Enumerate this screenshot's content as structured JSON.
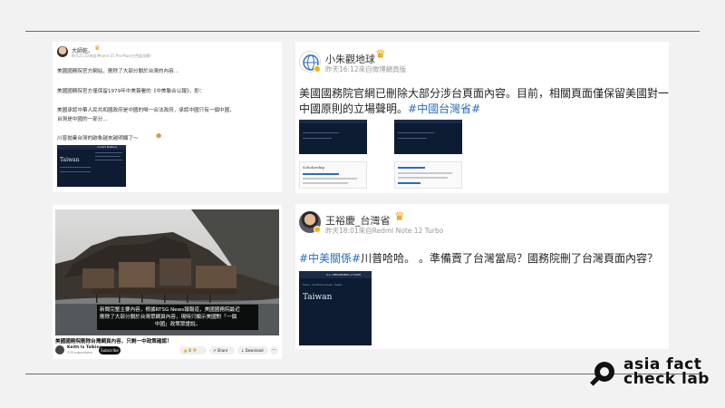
{
  "post1": {
    "user": "大師乾、",
    "meta": "昨天21:22來自iPhone 15 Pro Max(白色鈦金屬)",
    "lines": [
      "美國國務院官方網站，刪除了大部分關於台灣的內容...",
      "美國國務院官方僅保留1979年中美簽署的《中美聯合公報》，即：",
      "美國承認中華人民共和國政府是中國的唯一合法政府，承認中國只有一個中國，",
      "台灣是中國的一部分...",
      "川普拋棄台灣的跡象越來越明顯了～"
    ],
    "thumb_title": "Taiwan",
    "thumb_header": "Content Relations"
  },
  "post2": {
    "user": "小朱觀地球",
    "meta": "昨天16:12來自微博網頁版",
    "line1": "美國國務院官網已刪除大部分涉台頁面內容。目前，相關頁面僅保留美國對一個",
    "line2_text": "中國原則的立場聲明。",
    "line2_tag": "#中國台灣省#",
    "thumb_heading": "Scholarship"
  },
  "post3": {
    "caption_line1": "新聞完整主要內容，根據RTSG News報報道，美國國務院最近",
    "caption_line2": "刪除了大部分關於台灣眾網頁內容，現時只顯示美國對「一個",
    "caption_line3": "中國」政策眾證說。",
    "video_title": "美國國務院刪除台灣網頁內容，只剩一中政策確認！",
    "channel": "Keith Is Talking",
    "subs": "378 subscribers",
    "subscribe": "Subscribe",
    "likes": "0",
    "share": "Share",
    "download": "Download"
  },
  "post4": {
    "user": "王裕慶_台灣省",
    "meta": "昨天18:01來自Redmi Note 12 Turbo",
    "tag1": "#中美關係#",
    "text": "川普哈哈。 。準備賣了台灣當局？國務院刪了台灣頁面內容？",
    "thumb_header": "U.S. DEPARTMENT of STATE",
    "thumb_breadcrumb": "Home › Countries & Areas › Taiwan",
    "thumb_title": "Taiwan"
  },
  "logo": {
    "line1": "asia fact",
    "line2": "check lab"
  },
  "colors": {
    "accent": "#2a6ebd",
    "navy": "#0d1b33",
    "badge": "#f4b400"
  }
}
